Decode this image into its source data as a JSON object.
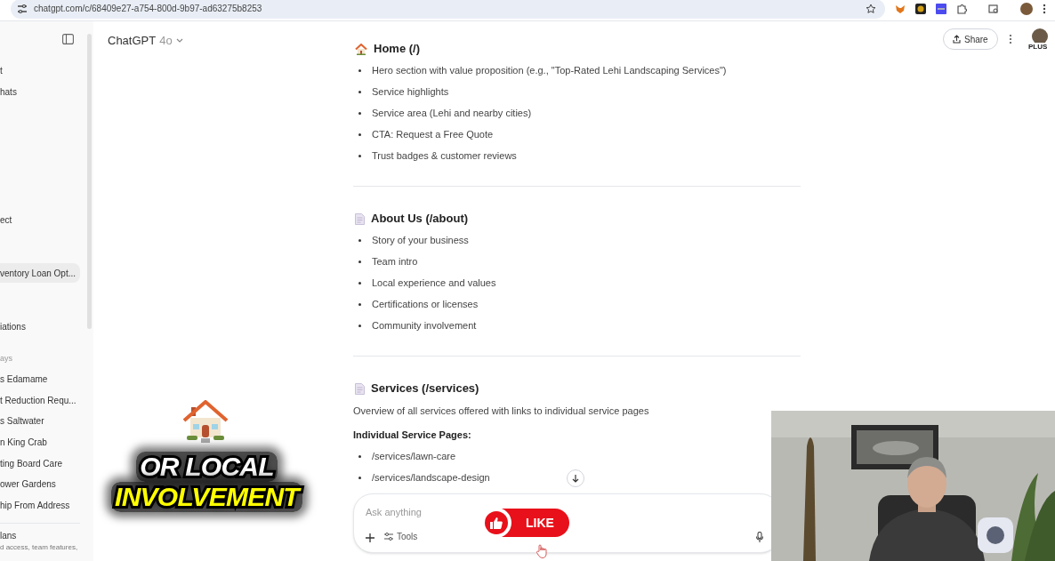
{
  "browser": {
    "url": "chatgpt.com/c/68409e27-a754-800d-9b97-ad63275b8253"
  },
  "sidebar": {
    "items": [
      {
        "label": "t",
        "selected": false
      },
      {
        "label": "hats",
        "selected": false
      },
      {
        "label": "ect",
        "selected": false
      },
      {
        "label": "ventory Loan Opt...",
        "selected": true
      },
      {
        "label": "iations",
        "selected": false
      }
    ],
    "section_label": "ays",
    "recent": [
      "s Edamame",
      "t Reduction Requ...",
      "s Saltwater",
      "n King Crab",
      "ting Board Care",
      "ower Gardens",
      "hip From Address"
    ],
    "footer": {
      "title": "lans",
      "subtitle": "d access, team features,"
    }
  },
  "header": {
    "model_name": "ChatGPT",
    "model_version": "4o",
    "share": "Share",
    "avatar_badge": "PLUS"
  },
  "sections": [
    {
      "kind": "house",
      "title": "Home (/)",
      "items": [
        "Hero section with value proposition (e.g., \"Top-Rated Lehi Landscaping Services\")",
        "Service highlights",
        "Service area (Lehi and nearby cities)",
        "CTA: Request a Free Quote",
        "Trust badges & customer reviews"
      ]
    },
    {
      "kind": "page",
      "title": "About Us (/about)",
      "items": [
        "Story of your business",
        "Team intro",
        "Local experience and values",
        "Certifications or licenses",
        "Community involvement"
      ]
    },
    {
      "kind": "page",
      "title": "Services (/services)",
      "intro": "Overview of all services offered with links to individual service pages",
      "subheading": "Individual Service Pages:",
      "items": [
        "/services/lawn-care",
        "/services/landscape-design"
      ]
    }
  ],
  "composer": {
    "placeholder": "Ask anything",
    "tools": "Tools"
  },
  "overlay": {
    "caption_lines": [
      {
        "text": "OR LOCAL",
        "kind": "plain"
      },
      {
        "text": "INVOLVEMENT",
        "kind": "highlight"
      }
    ],
    "like": "LIKE"
  }
}
